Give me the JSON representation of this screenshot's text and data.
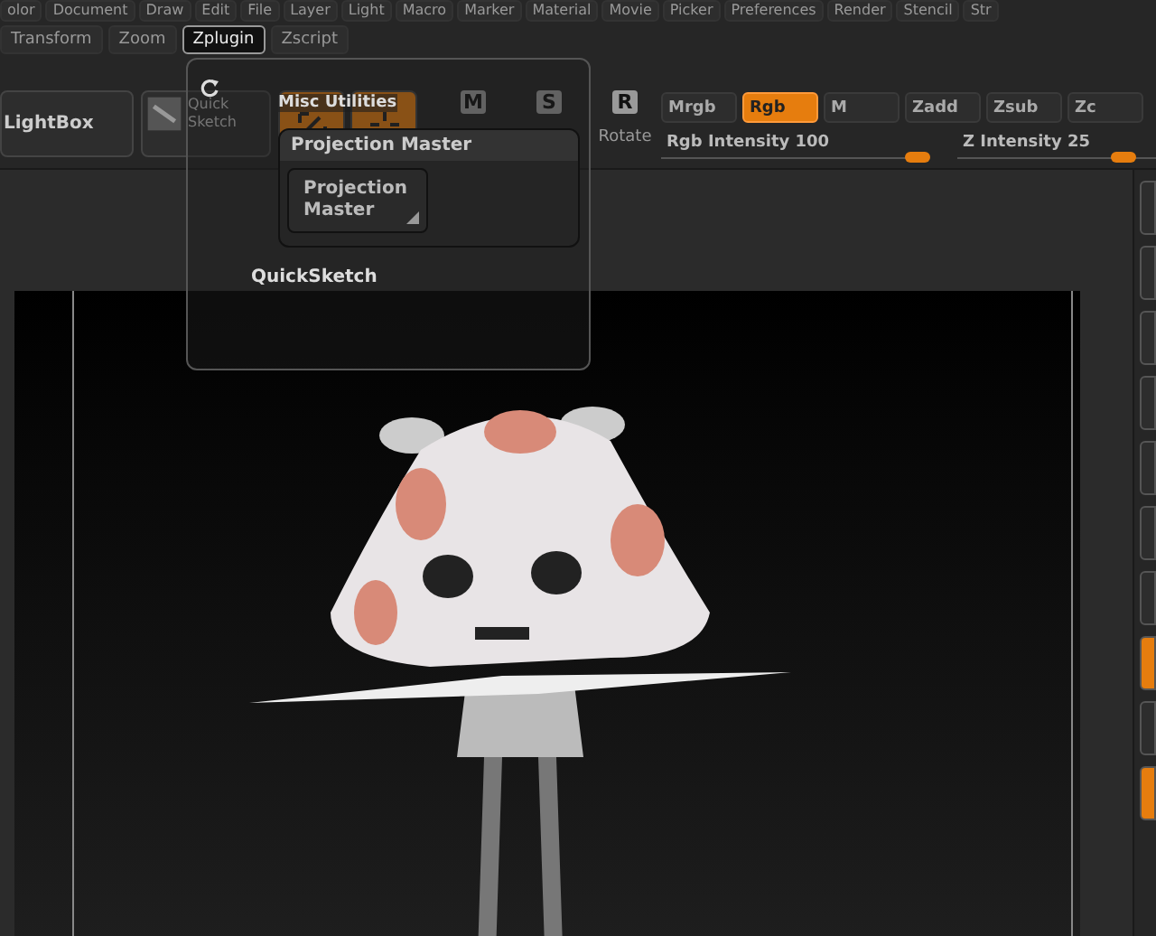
{
  "menu_rows": [
    [
      {
        "label": "olor",
        "selected": false
      },
      {
        "label": "Document",
        "selected": false
      },
      {
        "label": "Draw",
        "selected": false
      },
      {
        "label": "Edit",
        "selected": false
      },
      {
        "label": "File",
        "selected": false
      },
      {
        "label": "Layer",
        "selected": false
      },
      {
        "label": "Light",
        "selected": false
      },
      {
        "label": "Macro",
        "selected": false
      },
      {
        "label": "Marker",
        "selected": false
      },
      {
        "label": "Material",
        "selected": false
      },
      {
        "label": "Movie",
        "selected": false
      },
      {
        "label": "Picker",
        "selected": false
      },
      {
        "label": "Preferences",
        "selected": false
      },
      {
        "label": "Render",
        "selected": false
      },
      {
        "label": "Stencil",
        "selected": false
      },
      {
        "label": "Str",
        "selected": false
      }
    ],
    [
      {
        "label": "Transform",
        "selected": false
      },
      {
        "label": "Zoom",
        "selected": false
      },
      {
        "label": "Zplugin",
        "selected": true
      },
      {
        "label": "Zscript",
        "selected": false
      }
    ]
  ],
  "toolbar": {
    "lightbox": "LightBox",
    "quick_sketch": "Quick Sketch",
    "modes": [
      {
        "kind": "edit",
        "selected": true
      },
      {
        "kind": "draw",
        "selected": true
      }
    ],
    "transforms": [
      {
        "key": "M"
      },
      {
        "key": "S"
      },
      {
        "key": "R",
        "label": "Rotate"
      }
    ],
    "color_modes": [
      {
        "label": "Mrgb",
        "selected": false
      },
      {
        "label": "Rgb",
        "selected": true
      },
      {
        "label": "M",
        "selected": false
      },
      {
        "label": "Zadd",
        "selected": false
      },
      {
        "label": "Zsub",
        "selected": false
      },
      {
        "label": "Zc",
        "selected": false
      }
    ],
    "sliders": [
      {
        "label": "Rgb Intensity",
        "reading": "100",
        "level": 1.0
      },
      {
        "label": "Z Intensity",
        "reading": "25",
        "level": 0.65
      }
    ]
  },
  "popup": {
    "title": "Misc Utilities",
    "subpanel": {
      "title": "Projection Master",
      "button": "Projection Master"
    },
    "item": "QuickSketch"
  },
  "right_strip": [
    {
      "active": false
    },
    {
      "active": false
    },
    {
      "active": false
    },
    {
      "active": false
    },
    {
      "active": false
    },
    {
      "active": false
    },
    {
      "active": false
    },
    {
      "active": true
    },
    {
      "active": false
    },
    {
      "active": true
    }
  ]
}
